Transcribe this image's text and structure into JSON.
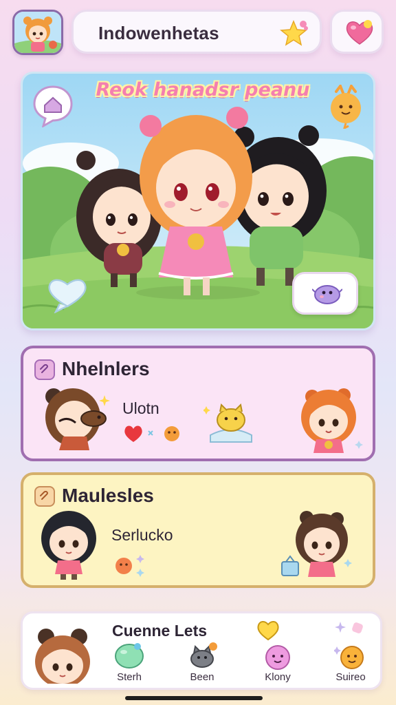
{
  "header": {
    "title": "Indowenhetas",
    "icons": [
      "avatar-icon",
      "star-icon",
      "heart-icon"
    ]
  },
  "hero": {
    "title": "Reok hanadsr peanu",
    "icons": [
      "home-bubble-icon",
      "sun-sprite-icon",
      "chat-bubble-icon",
      "purple-creature-icon"
    ]
  },
  "cards": [
    {
      "title": "Nhelnlers",
      "subtitle": "Ulotn",
      "accent": "#a06eb0",
      "background": "#fbe4f6"
    },
    {
      "title": "Maulesles",
      "subtitle": "Serlucko",
      "accent": "#d5b06c",
      "background": "#fdf4c2"
    }
  ],
  "bottom": {
    "title": "Cuenne Lets",
    "items": [
      {
        "label": "Sterh",
        "icon": "green-blob-icon"
      },
      {
        "label": "Been",
        "icon": "gray-cat-icon"
      },
      {
        "label": "Klony",
        "icon": "pink-blob-icon"
      },
      {
        "label": "Suireo",
        "icon": "orange-blob-icon"
      }
    ]
  },
  "colors": {
    "primary_purple": "#a06eb0",
    "card_pink": "#fbe4f6",
    "card_yellow": "#fdf4c2",
    "heart_pink": "#f06a9c",
    "star_yellow": "#ffd84a"
  }
}
